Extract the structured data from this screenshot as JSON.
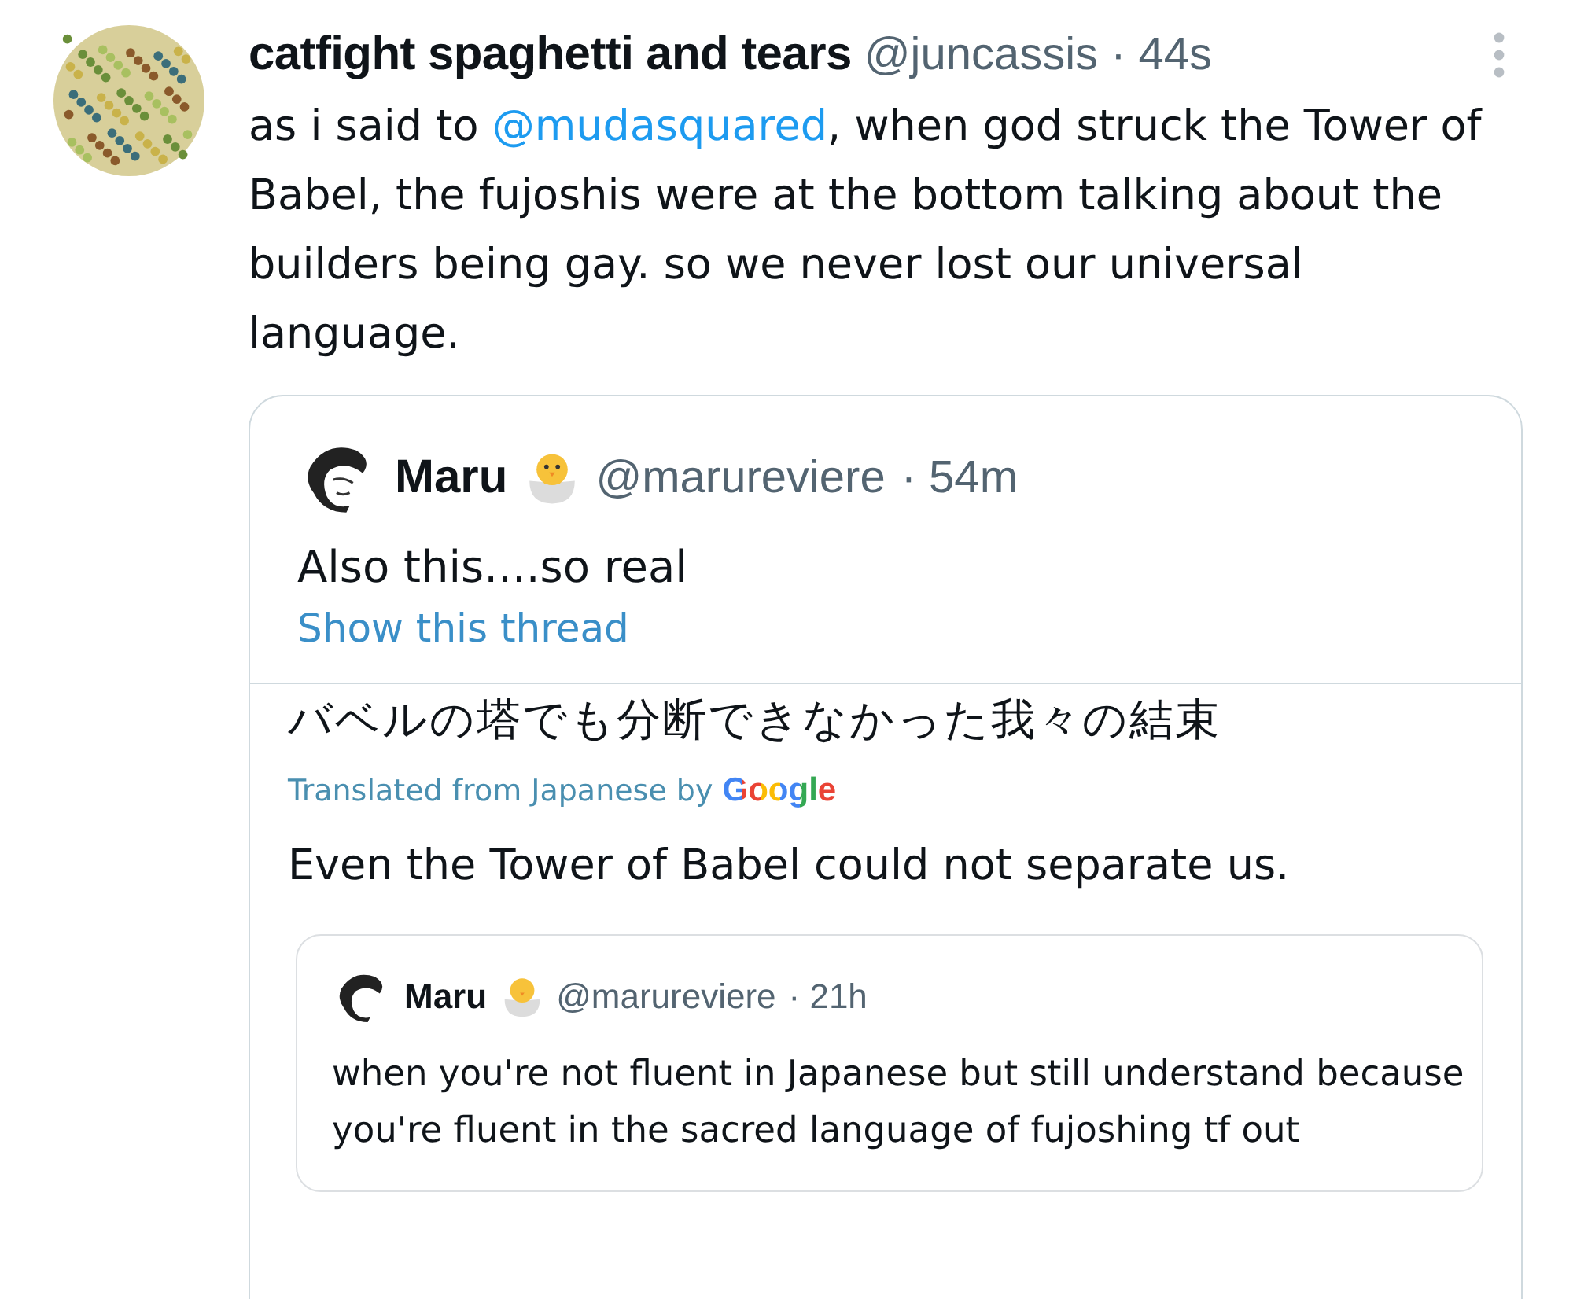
{
  "tweet": {
    "name": "catfight spaghetti and tears",
    "handle": "@juncassis",
    "time": "· 44s",
    "text_before": "as i said to ",
    "mention": "@mudasquared",
    "text_after": ", when god struck the Tower of Babel, the fujoshis were at the bottom talking about the builders being gay. so we never lost our universal language."
  },
  "quote": {
    "name": "Maru",
    "handle": "@marureviere",
    "time": "· 54m",
    "text": "Also this....so real",
    "thread_link": "Show this thread",
    "original": "バベルの塔でも分断できなかった我々の結束",
    "translated_label": "Translated from Japanese by",
    "translator": "Google",
    "translation": "Even the Tower of Babel could not separate us."
  },
  "nested_quote": {
    "name": "Maru",
    "handle": "@marureviere",
    "time": "· 21h",
    "text": "when you're not fluent in Japanese but still understand because you're fluent in the sacred language of fujoshing tf out"
  }
}
